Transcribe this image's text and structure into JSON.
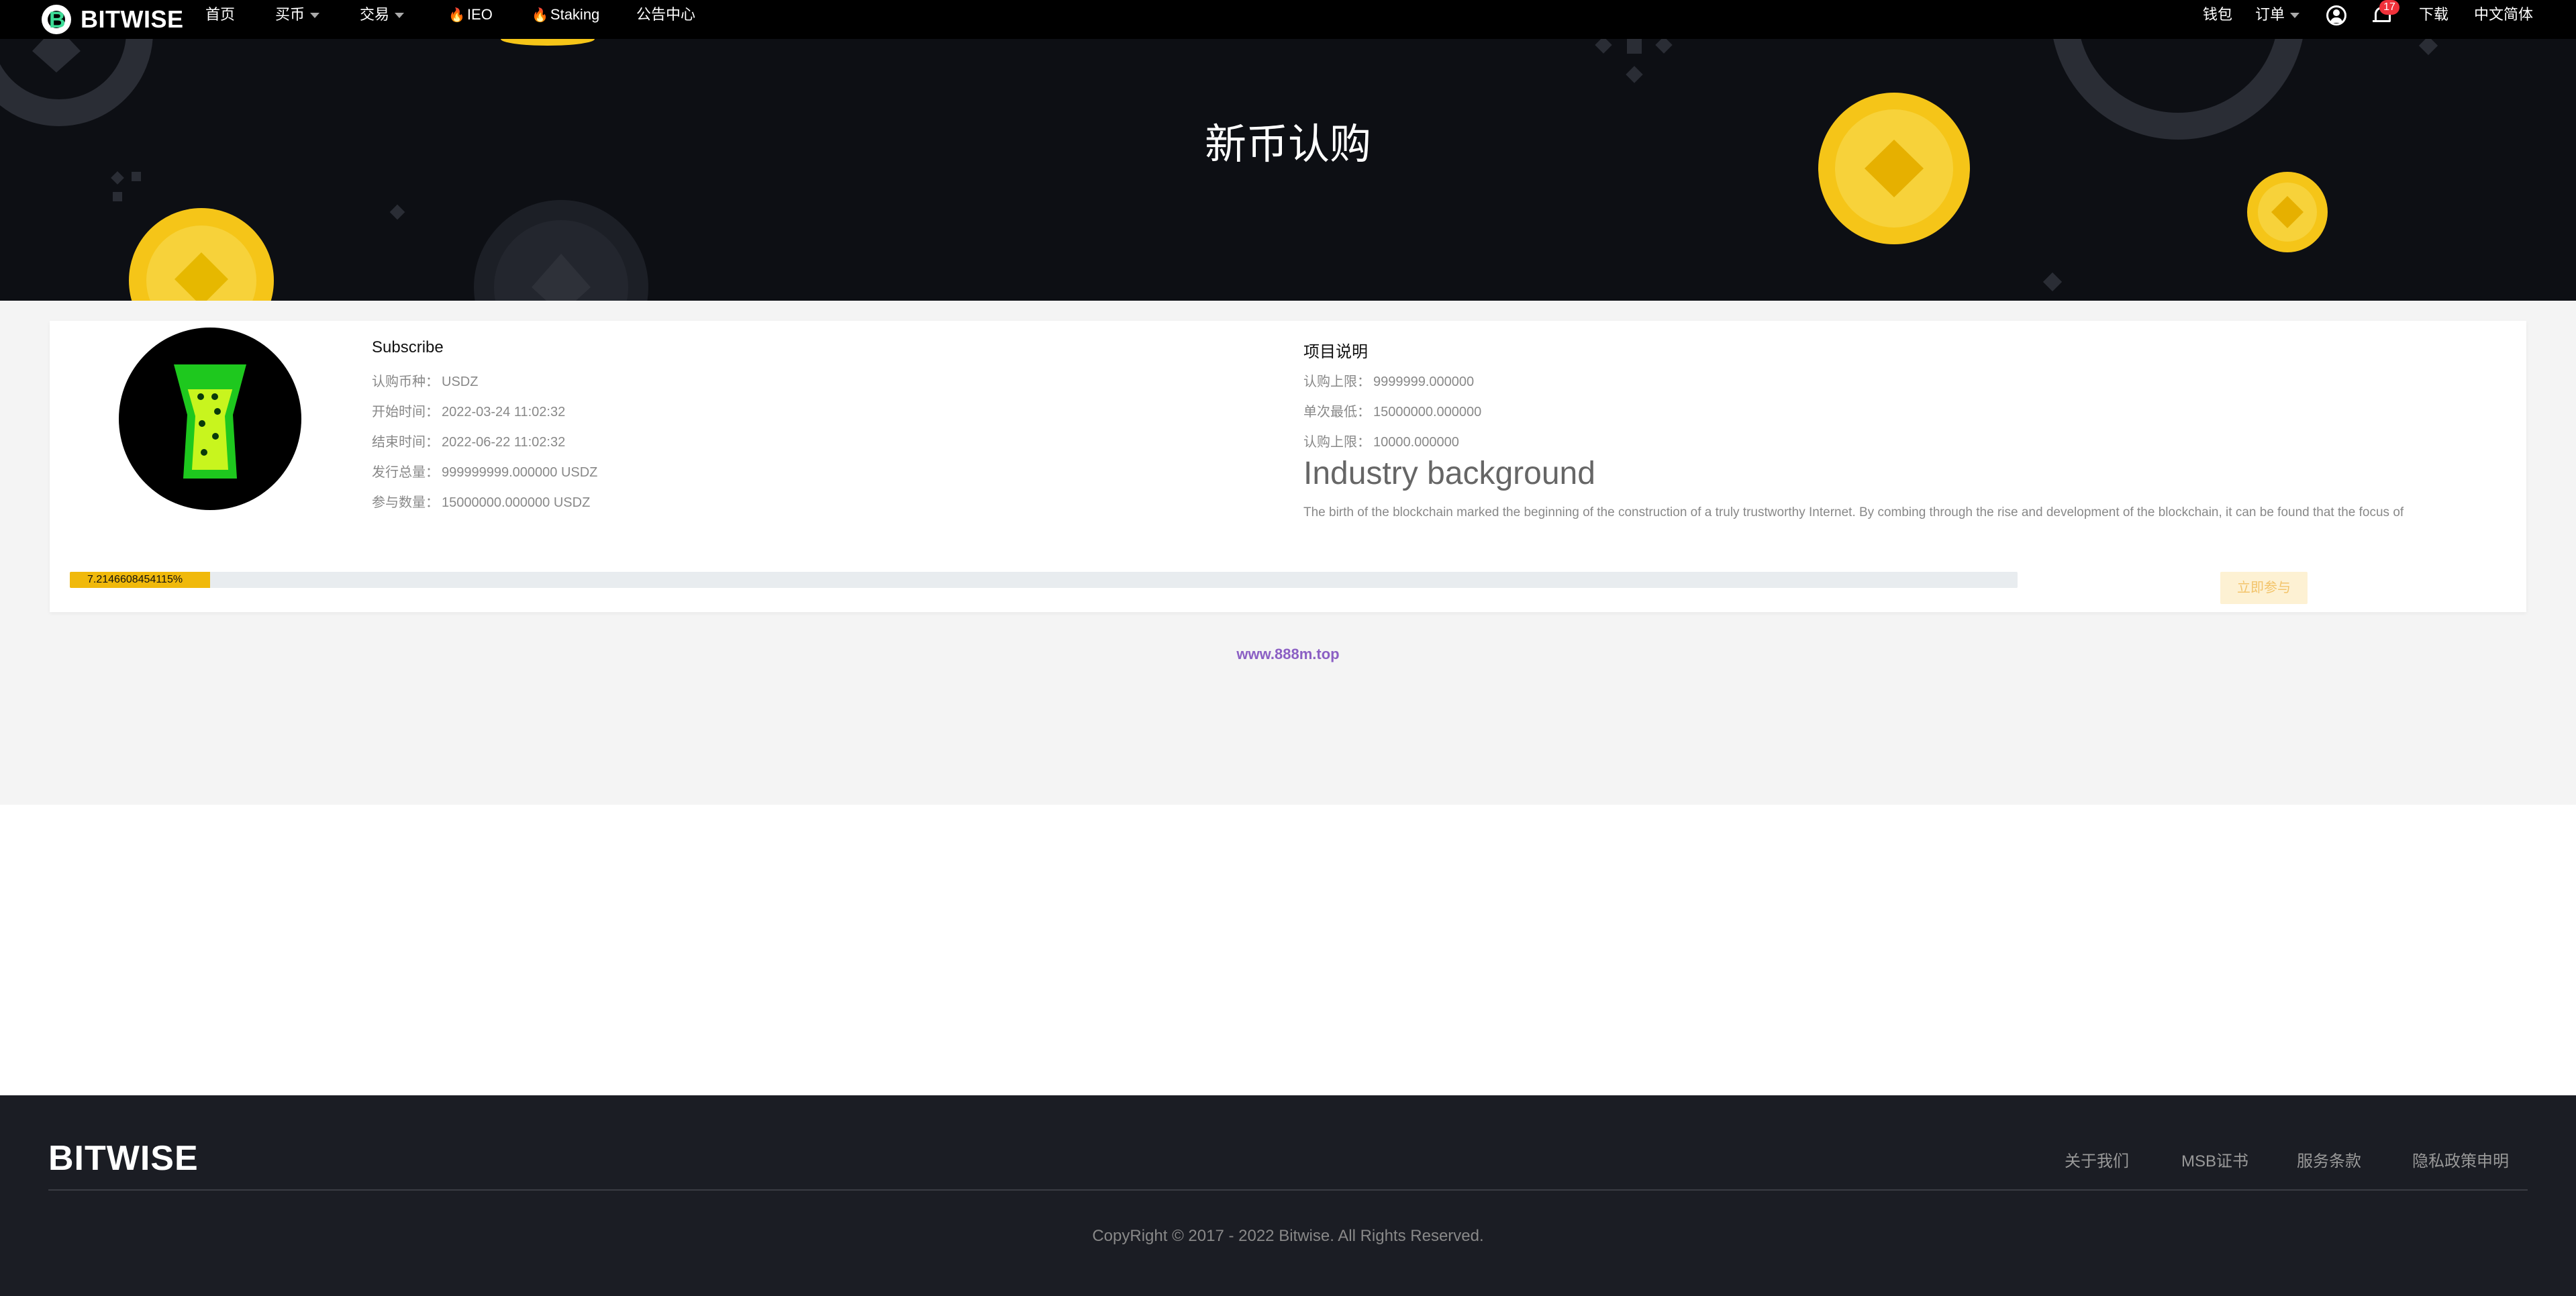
{
  "nav": {
    "brand": "BITWISE",
    "items": [
      {
        "label": "首页"
      },
      {
        "label": "买币"
      },
      {
        "label": "交易"
      },
      {
        "label": "IEO"
      },
      {
        "label": "Staking"
      },
      {
        "label": "公告中心"
      }
    ],
    "right": {
      "wallet": "钱包",
      "orders": "订单",
      "notification_count": "17",
      "download": "下载",
      "language": "中文简体"
    }
  },
  "banner": {
    "title": "新币认购"
  },
  "project": {
    "subscribe_title": "Subscribe",
    "left_rows": [
      {
        "label": "认购币种：",
        "value": "USDZ"
      },
      {
        "label": "开始时间：",
        "value": "2022-03-24 11:02:32"
      },
      {
        "label": "结束时间：",
        "value": "2022-06-22 11:02:32"
      },
      {
        "label": "发行总量：",
        "value": "999999999.000000 USDZ"
      },
      {
        "label": "参与数量：",
        "value": "15000000.000000 USDZ"
      }
    ],
    "desc_title": "项目说明",
    "right_rows": [
      {
        "label": "认购上限：",
        "value": "9999999.000000"
      },
      {
        "label": "单次最低：",
        "value": "15000000.000000"
      },
      {
        "label": "认购上限：",
        "value": "10000.000000"
      }
    ],
    "industry_title": "Industry background",
    "industry_text": "The birth of the blockchain marked the beginning of the construction of a truly trustworthy Internet. By combing through the rise and development of the blockchain, it can be found that the focus of",
    "progress_label": "7.2146608454115%",
    "progress_fraction": 0.072146608454115,
    "join_button": "立即参与"
  },
  "watermark": "www.888m.top",
  "footer": {
    "brand": "BITWISE",
    "links": [
      {
        "label": "关于我们"
      },
      {
        "label": "MSB证书"
      },
      {
        "label": "服务条款"
      },
      {
        "label": "隐私政策申明"
      }
    ],
    "copyright": "CopyRight © 2017 - 2022 Bitwise. All Rights Reserved."
  },
  "colors": {
    "nav_bg": "#000000",
    "banner_bg": "#0d0f14",
    "accent_yellow": "#f0b90b",
    "coin_yellow": "#f5c518",
    "brand_green": "#3ddc97",
    "badge_red": "#f0313a",
    "footer_bg": "#1b1d24",
    "watermark_purple": "#8b5fc4"
  }
}
